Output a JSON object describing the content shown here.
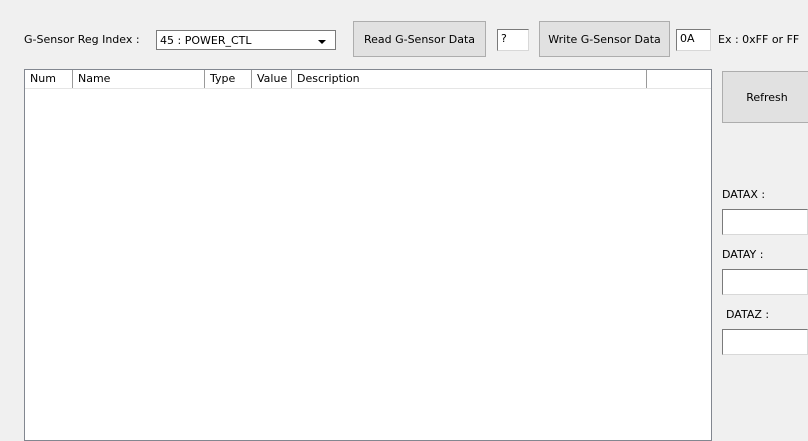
{
  "reg_index": {
    "label": "G-Sensor Reg Index :",
    "selected": "45 : POWER_CTL"
  },
  "read_button": "Read G-Sensor Data",
  "read_value": "?",
  "write_button": "Write G-Sensor Data",
  "write_value": "0A",
  "example_hint": "Ex : 0xFF or FF",
  "table": {
    "columns": [
      "Num",
      "Name",
      "Type",
      "Value",
      "Description"
    ],
    "rows": []
  },
  "refresh_button": "Refresh",
  "data_x": {
    "label": "DATAX :",
    "value": ""
  },
  "data_y": {
    "label": "DATAY :",
    "value": ""
  },
  "data_z": {
    "label": "DATAZ :",
    "value": ""
  }
}
